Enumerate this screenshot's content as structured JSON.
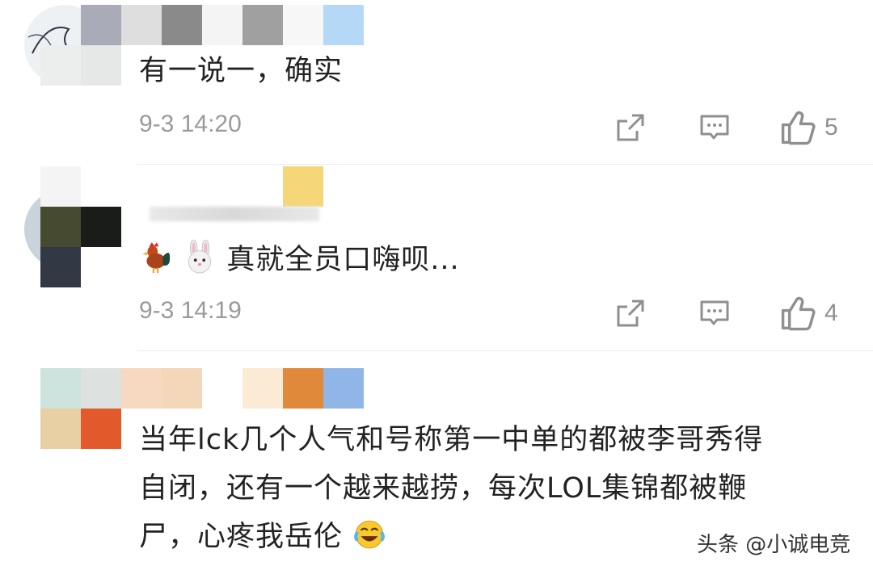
{
  "comments": [
    {
      "text": "有一说一，确实",
      "time": "9-3 14:20",
      "likes": "5"
    },
    {
      "emoji": [
        "rooster-emoji",
        "rabbit-emoji"
      ],
      "text": "真就全员口嗨呗...",
      "time": "9-3 14:19",
      "likes": "4"
    },
    {
      "text_lines": [
        "当年lck几个人气和号称第一中单的都被李哥秀得",
        "自闭，还有一个越来越捞，每次LOL集锦都被鞭",
        "尸，心疼我岳伦"
      ],
      "trailing_emoji": "laughing-crying-emoji"
    }
  ],
  "icons": {
    "share": "share-icon",
    "reply": "reply-icon",
    "like": "thumbs-up-icon"
  },
  "watermark": "头条 @小诚电竞",
  "colors": {
    "meta_text": "#9a9a9a",
    "icon": "#8f8f8f"
  }
}
